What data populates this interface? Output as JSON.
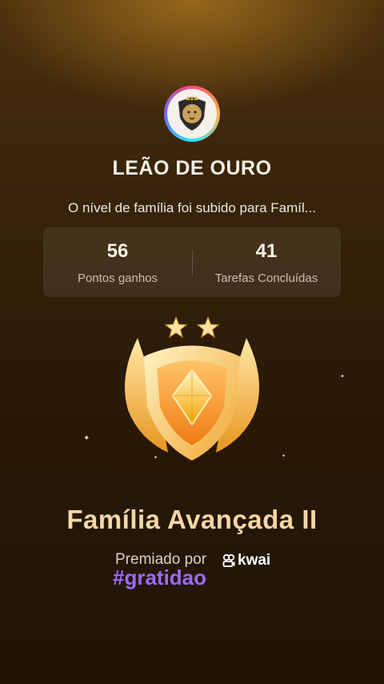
{
  "profile": {
    "name": "LEÃO DE OURO",
    "message": "O nível de família foi subido para Famíl..."
  },
  "stats": {
    "points_value": "56",
    "points_label": "Pontos ganhos",
    "tasks_value": "41",
    "tasks_label": "Tarefas Concluídas"
  },
  "badge": {
    "level_title": "Família Avançada II",
    "stars": 2
  },
  "footer": {
    "awarded_by": "Premiado por",
    "brand": "kwai",
    "hashtag": "#gratidao"
  },
  "colors": {
    "title": "#f6d6a8",
    "hashtag": "#9b6bff"
  }
}
